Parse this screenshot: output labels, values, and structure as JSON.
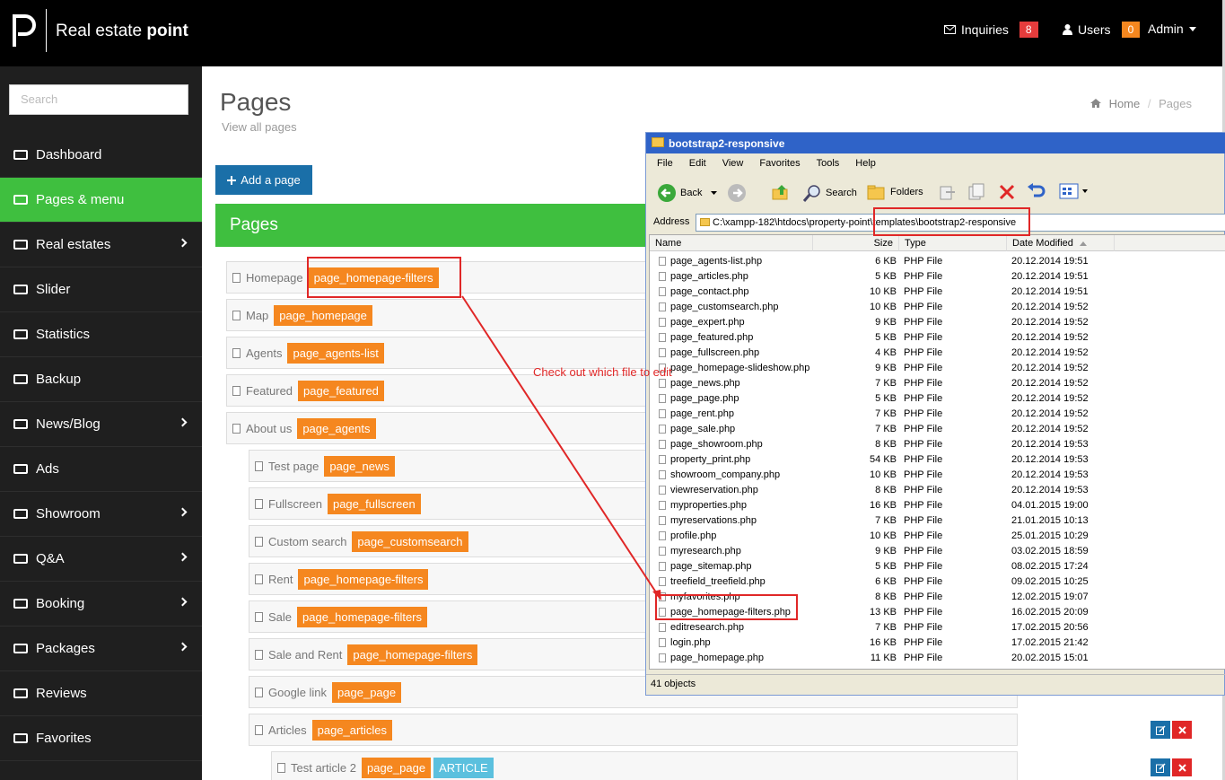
{
  "header": {
    "brand_regular": "Real estate ",
    "brand_bold": "point",
    "inquiries_label": "Inquiries",
    "inquiries_count": "8",
    "users_label": "Users",
    "users_count": "0",
    "admin_label": "Admin"
  },
  "sidebar": {
    "search_placeholder": "Search",
    "items": [
      {
        "label": "Dashboard",
        "icon": "monitor-icon",
        "chevron": false,
        "active": false
      },
      {
        "label": "Pages & menu",
        "icon": "sitemap-icon",
        "chevron": false,
        "active": true
      },
      {
        "label": "Real estates",
        "icon": "map-marker-icon",
        "chevron": true,
        "active": false
      },
      {
        "label": "Slider",
        "icon": "image-icon",
        "chevron": false,
        "active": false
      },
      {
        "label": "Statistics",
        "icon": "bar-chart-icon",
        "chevron": false,
        "active": false
      },
      {
        "label": "Backup",
        "icon": "hdd-icon",
        "chevron": false,
        "active": false
      },
      {
        "label": "News/Blog",
        "icon": "book-icon",
        "chevron": true,
        "active": false
      },
      {
        "label": "Ads",
        "icon": "globe-icon",
        "chevron": false,
        "active": false
      },
      {
        "label": "Showroom",
        "icon": "briefcase-icon",
        "chevron": true,
        "active": false
      },
      {
        "label": "Q&A",
        "icon": "comment-icon",
        "chevron": true,
        "active": false
      },
      {
        "label": "Booking",
        "icon": "cart-icon",
        "chevron": true,
        "active": false
      },
      {
        "label": "Packages",
        "icon": "gift-icon",
        "chevron": true,
        "active": false
      },
      {
        "label": "Reviews",
        "icon": "tags-icon",
        "chevron": false,
        "active": false
      },
      {
        "label": "Favorites",
        "icon": "star-icon",
        "chevron": false,
        "active": false
      }
    ]
  },
  "main": {
    "title": "Pages",
    "subtitle": "View all pages",
    "breadcrumb": {
      "home": "Home",
      "separator": "/",
      "current": "Pages"
    },
    "add_button": "Add a page",
    "panel_title": "Pages",
    "rows": [
      {
        "name": "Homepage",
        "tag": "page_homepage-filters"
      },
      {
        "name": "Map",
        "tag": "page_homepage"
      },
      {
        "name": "Agents",
        "tag": "page_agents-list"
      },
      {
        "name": "Featured",
        "tag": "page_featured"
      },
      {
        "name": "About us",
        "tag": "page_agents"
      },
      {
        "name": "Test page",
        "tag": "page_news"
      },
      {
        "name": "Fullscreen",
        "tag": "page_fullscreen"
      },
      {
        "name": "Custom search",
        "tag": "page_customsearch"
      },
      {
        "name": "Rent",
        "tag": "page_homepage-filters"
      },
      {
        "name": "Sale",
        "tag": "page_homepage-filters"
      },
      {
        "name": "Sale and Rent",
        "tag": "page_homepage-filters"
      },
      {
        "name": "Google link",
        "tag": "page_page"
      },
      {
        "name": "Articles",
        "tag": "page_articles"
      },
      {
        "name": "Test article 2",
        "tag": "page_page",
        "extra_tag": "ARTICLE"
      }
    ],
    "annotation": "Check out which file to edit"
  },
  "explorer": {
    "title": "bootstrap2-responsive",
    "menu": [
      "File",
      "Edit",
      "View",
      "Favorites",
      "Tools",
      "Help"
    ],
    "toolbar": {
      "back": "Back",
      "search": "Search",
      "folders": "Folders"
    },
    "address_label": "Address",
    "address": "C:\\xampp-182\\htdocs\\property-point\\templates\\bootstrap2-responsive",
    "columns": [
      "Name",
      "Size",
      "Type",
      "Date Modified"
    ],
    "files": [
      [
        "page_agents-list.php",
        "6 KB",
        "PHP File",
        "20.12.2014 19:51"
      ],
      [
        "page_articles.php",
        "5 KB",
        "PHP File",
        "20.12.2014 19:51"
      ],
      [
        "page_contact.php",
        "10 KB",
        "PHP File",
        "20.12.2014 19:51"
      ],
      [
        "page_customsearch.php",
        "10 KB",
        "PHP File",
        "20.12.2014 19:52"
      ],
      [
        "page_expert.php",
        "9 KB",
        "PHP File",
        "20.12.2014 19:52"
      ],
      [
        "page_featured.php",
        "5 KB",
        "PHP File",
        "20.12.2014 19:52"
      ],
      [
        "page_fullscreen.php",
        "4 KB",
        "PHP File",
        "20.12.2014 19:52"
      ],
      [
        "page_homepage-slideshow.php",
        "9 KB",
        "PHP File",
        "20.12.2014 19:52"
      ],
      [
        "page_news.php",
        "7 KB",
        "PHP File",
        "20.12.2014 19:52"
      ],
      [
        "page_page.php",
        "5 KB",
        "PHP File",
        "20.12.2014 19:52"
      ],
      [
        "page_rent.php",
        "7 KB",
        "PHP File",
        "20.12.2014 19:52"
      ],
      [
        "page_sale.php",
        "7 KB",
        "PHP File",
        "20.12.2014 19:52"
      ],
      [
        "page_showroom.php",
        "8 KB",
        "PHP File",
        "20.12.2014 19:53"
      ],
      [
        "property_print.php",
        "54 KB",
        "PHP File",
        "20.12.2014 19:53"
      ],
      [
        "showroom_company.php",
        "10 KB",
        "PHP File",
        "20.12.2014 19:53"
      ],
      [
        "viewreservation.php",
        "8 KB",
        "PHP File",
        "20.12.2014 19:53"
      ],
      [
        "myproperties.php",
        "16 KB",
        "PHP File",
        "04.01.2015 19:00"
      ],
      [
        "myreservations.php",
        "7 KB",
        "PHP File",
        "21.01.2015 10:13"
      ],
      [
        "profile.php",
        "10 KB",
        "PHP File",
        "25.01.2015 10:29"
      ],
      [
        "myresearch.php",
        "9 KB",
        "PHP File",
        "03.02.2015 18:59"
      ],
      [
        "page_sitemap.php",
        "5 KB",
        "PHP File",
        "08.02.2015 17:24"
      ],
      [
        "treefield_treefield.php",
        "6 KB",
        "PHP File",
        "09.02.2015 10:25"
      ],
      [
        "myfavorites.php",
        "8 KB",
        "PHP File",
        "12.02.2015 19:07"
      ],
      [
        "page_homepage-filters.php",
        "13 KB",
        "PHP File",
        "16.02.2015 20:09"
      ],
      [
        "editresearch.php",
        "7 KB",
        "PHP File",
        "17.02.2015 20:56"
      ],
      [
        "login.php",
        "16 KB",
        "PHP File",
        "17.02.2015 21:42"
      ],
      [
        "page_homepage.php",
        "11 KB",
        "PHP File",
        "20.02.2015 15:01"
      ]
    ],
    "status": "41 objects"
  }
}
